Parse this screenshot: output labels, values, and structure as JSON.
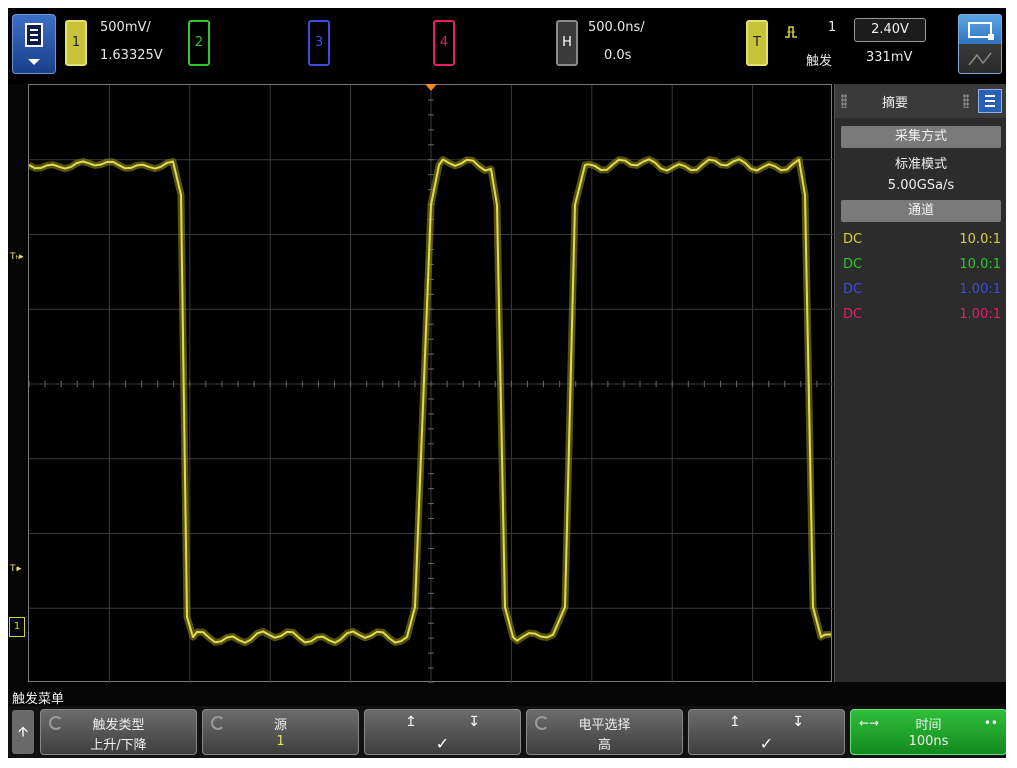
{
  "top": {
    "ch1": {
      "num": "1",
      "scale": "500mV/",
      "offset": "1.63325V"
    },
    "ch2": {
      "num": "2"
    },
    "ch3": {
      "num": "3"
    },
    "ch4": {
      "num": "4"
    },
    "horiz": {
      "label": "H",
      "scale": "500.0ns/",
      "delay": "0.0s"
    },
    "trigger": {
      "label": "T",
      "source": "1",
      "mode": "触发",
      "level_box": "2.40V",
      "level": "331mV"
    }
  },
  "panel": {
    "title": "摘要",
    "acq_header": "采集方式",
    "acq_mode": "标准模式",
    "sample_rate": "5.00GSa/s",
    "chan_header": "通道",
    "channels": [
      {
        "coupling": "DC",
        "probe": "10.0:1",
        "color": "#d8d23a"
      },
      {
        "coupling": "DC",
        "probe": "10.0:1",
        "color": "#2ec72e"
      },
      {
        "coupling": "DC",
        "probe": "1.00:1",
        "color": "#3a4fdd"
      },
      {
        "coupling": "DC",
        "probe": "1.00:1",
        "color": "#e0206a"
      }
    ]
  },
  "markers": {
    "th": "Tₕ",
    "tl": "Tₗ",
    "ch_ground": "1"
  },
  "menu": {
    "title": "触发菜单",
    "keys": [
      {
        "line1": "触发类型",
        "line2": "上升/下降"
      },
      {
        "line1": "源",
        "line2": "1"
      },
      {
        "line1": "",
        "line2": "✓"
      },
      {
        "line1": "电平选择",
        "line2": "高"
      },
      {
        "line1": "",
        "line2": "✓"
      },
      {
        "line1": "时间",
        "line2": "100ns"
      }
    ]
  },
  "colors": {
    "ch1": "#d8d23a",
    "ch2": "#2ec72e",
    "ch3": "#3a4fdd",
    "ch4": "#e0206a",
    "accent": "#f08a1e"
  }
}
